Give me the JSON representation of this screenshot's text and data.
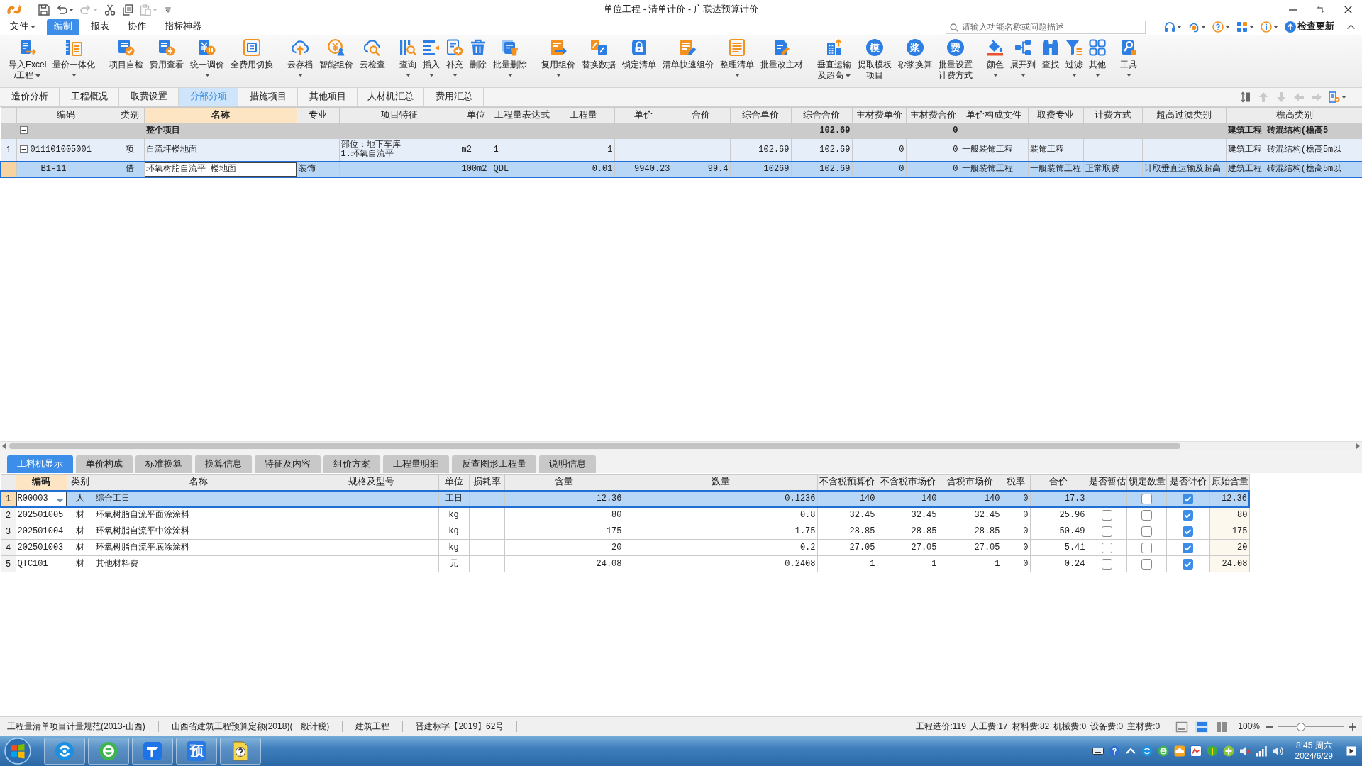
{
  "window": {
    "title": "单位工程 - 清单计价 - 广联达预算计价"
  },
  "quick_access": [
    {
      "kind": "save",
      "disabled": false,
      "dropdown": false
    },
    {
      "kind": "undo",
      "disabled": false,
      "dropdown": true
    },
    {
      "kind": "redo",
      "disabled": true,
      "dropdown": true
    },
    {
      "kind": "cut",
      "disabled": false,
      "dropdown": false
    },
    {
      "kind": "copy",
      "disabled": false,
      "dropdown": false
    },
    {
      "kind": "paste",
      "disabled": true,
      "dropdown": true
    },
    {
      "kind": "customize",
      "disabled": false,
      "dropdown": false
    }
  ],
  "menu": [
    {
      "label": "文件",
      "dropdown": true,
      "selected": false
    },
    {
      "label": "编制",
      "dropdown": false,
      "selected": true
    },
    {
      "label": "报表",
      "dropdown": false,
      "selected": false
    },
    {
      "label": "协作",
      "dropdown": false,
      "selected": false
    },
    {
      "label": "指标神器",
      "dropdown": false,
      "selected": false
    }
  ],
  "search": {
    "placeholder": "请输入功能名称或问题描述"
  },
  "update_button": {
    "label": "检查更新"
  },
  "toolbar": [
    [
      {
        "kind": "import",
        "lines": [
          "导入Excel",
          "/工程"
        ],
        "dropdown": true
      },
      {
        "kind": "bundle",
        "lines": [
          "量价一体化"
        ],
        "dropdown": true
      }
    ],
    [
      {
        "kind": "selfcheck",
        "lines": [
          "项目自检"
        ],
        "dropdown": false
      },
      {
        "kind": "feeview",
        "lines": [
          "费用查看"
        ],
        "dropdown": false
      },
      {
        "kind": "unify",
        "lines": [
          "统一调价"
        ],
        "dropdown": true
      },
      {
        "kind": "fullfee",
        "lines": [
          "全费用切换"
        ],
        "dropdown": false
      }
    ],
    [
      {
        "kind": "cloudup",
        "lines": [
          "云存档"
        ],
        "dropdown": true
      },
      {
        "kind": "smartprice",
        "lines": [
          "智能组价"
        ],
        "dropdown": false
      },
      {
        "kind": "cloudcheck",
        "lines": [
          "云检查"
        ],
        "dropdown": false
      }
    ],
    [
      {
        "kind": "query",
        "lines": [
          "查询"
        ],
        "dropdown": true
      },
      {
        "kind": "insert",
        "lines": [
          "插入"
        ],
        "dropdown": true
      },
      {
        "kind": "supplement",
        "lines": [
          "补充"
        ],
        "dropdown": true
      },
      {
        "kind": "delete",
        "lines": [
          "删除"
        ],
        "dropdown": false
      },
      {
        "kind": "batchdelete",
        "lines": [
          "批量删除"
        ],
        "dropdown": true
      }
    ],
    [
      {
        "kind": "reuse",
        "lines": [
          "复用组价"
        ],
        "dropdown": true
      },
      {
        "kind": "replace",
        "lines": [
          "替换数据"
        ],
        "dropdown": false
      },
      {
        "kind": "lock",
        "lines": [
          "锁定清单"
        ],
        "dropdown": false
      },
      {
        "kind": "quickprice",
        "lines": [
          "清单快速组价"
        ],
        "dropdown": false
      },
      {
        "kind": "organize",
        "lines": [
          "整理清单"
        ],
        "dropdown": true
      },
      {
        "kind": "batchmaterial",
        "lines": [
          "批量改主材"
        ],
        "dropdown": false
      }
    ],
    [
      {
        "kind": "vertical",
        "lines": [
          "垂直运输",
          "及超高"
        ],
        "dropdown": true
      },
      {
        "kind": "glyph",
        "glyph": "模",
        "lines": [
          "提取模板",
          "项目"
        ],
        "dropdown": false
      },
      {
        "kind": "glyph",
        "glyph": "浆",
        "lines": [
          "砂浆换算"
        ],
        "dropdown": false
      },
      {
        "kind": "glyph",
        "glyph": "费",
        "lines": [
          "批量设置",
          "计费方式"
        ],
        "dropdown": false
      }
    ],
    [
      {
        "kind": "color",
        "lines": [
          "颜色"
        ],
        "dropdown": true
      },
      {
        "kind": "expandto",
        "lines": [
          "展开到"
        ],
        "dropdown": true
      },
      {
        "kind": "find",
        "lines": [
          "查找"
        ],
        "dropdown": false
      },
      {
        "kind": "filter",
        "lines": [
          "过滤"
        ],
        "dropdown": true
      },
      {
        "kind": "other",
        "lines": [
          "其他"
        ],
        "dropdown": true
      }
    ],
    [
      {
        "kind": "tools",
        "lines": [
          "工具"
        ],
        "dropdown": true
      }
    ]
  ],
  "main_tabs": [
    {
      "label": "造价分析",
      "selected": false
    },
    {
      "label": "工程概况",
      "selected": false
    },
    {
      "label": "取费设置",
      "selected": false
    },
    {
      "label": "分部分项",
      "selected": true
    },
    {
      "label": "措施项目",
      "selected": false
    },
    {
      "label": "其他项目",
      "selected": false
    },
    {
      "label": "人材机汇总",
      "selected": false
    },
    {
      "label": "费用汇总",
      "selected": false
    }
  ],
  "view_tools": [
    {
      "kind": "sort",
      "disabled": false
    },
    {
      "kind": "up",
      "disabled": true
    },
    {
      "kind": "down",
      "disabled": true
    },
    {
      "kind": "left",
      "disabled": true
    },
    {
      "kind": "right",
      "disabled": true
    },
    {
      "kind": "settings",
      "disabled": false
    }
  ],
  "bill_table": {
    "columns": [
      {
        "label": "编码",
        "selected": false
      },
      {
        "label": "类别",
        "selected": false
      },
      {
        "label": "名称",
        "selected": true
      },
      {
        "label": "专业",
        "selected": false
      },
      {
        "label": "项目特征",
        "selected": false
      },
      {
        "label": "单位",
        "selected": false
      },
      {
        "label": "工程量表达式",
        "selected": false
      },
      {
        "label": "工程量",
        "selected": false
      },
      {
        "label": "单价",
        "selected": false
      },
      {
        "label": "合价",
        "selected": false
      },
      {
        "label": "综合单价",
        "selected": false
      },
      {
        "label": "综合合价",
        "selected": false
      },
      {
        "label": "主材费单价",
        "selected": false
      },
      {
        "label": "主材费合价",
        "selected": false
      },
      {
        "label": "单价构成文件",
        "selected": false
      },
      {
        "label": "取费专业",
        "selected": false
      },
      {
        "label": "计费方式",
        "selected": false
      },
      {
        "label": "超高过滤类别",
        "selected": false
      },
      {
        "label": "檐高类别",
        "selected": false
      }
    ],
    "rows": [
      {
        "kind": "group",
        "expanded": true,
        "selected": false,
        "editing": false,
        "name": "整个项目",
        "composite_amount": "102.69",
        "main_amount": "0",
        "eave_type": "建筑工程 砖混结构(檐高5"
      },
      {
        "kind": "item",
        "number": "1",
        "expanded": true,
        "selected": false,
        "editing": false,
        "code": "011101005001",
        "type": "项",
        "name": "自流坪楼地面",
        "features": "部位：地下车库\n1.环氧自流平",
        "unit": "m2",
        "qty_expr": "1",
        "qty": "1",
        "composite_price": "102.69",
        "composite_amount": "102.69",
        "main_price": "0",
        "main_amount": "0",
        "price_file": "一般装饰工程",
        "fee_specialty": "装饰工程",
        "eave_type": "建筑工程 砖混结构(檐高5m以"
      },
      {
        "kind": "sub",
        "selected": true,
        "editing": true,
        "code": "B1-11",
        "type": "借",
        "name": "环氧树脂自流平 楼地面",
        "specialty": "装饰",
        "unit": "100m2",
        "qty_expr": "QDL",
        "qty": "0.01",
        "unit_price": "9940.23",
        "amount": "99.4",
        "composite_price": "10269",
        "composite_amount": "102.69",
        "main_price": "0",
        "main_amount": "0",
        "price_file": "一般装饰工程",
        "fee_specialty": "一般装饰工程",
        "fee_method": "正常取费",
        "height_filter": "计取垂直运输及超高",
        "eave_type": "建筑工程 砖混结构(檐高5m以"
      }
    ]
  },
  "resource_tabs": [
    {
      "label": "工料机显示",
      "selected": true
    },
    {
      "label": "单价构成",
      "selected": false
    },
    {
      "label": "标准换算",
      "selected": false
    },
    {
      "label": "换算信息",
      "selected": false
    },
    {
      "label": "特征及内容",
      "selected": false
    },
    {
      "label": "组价方案",
      "selected": false
    },
    {
      "label": "工程量明细",
      "selected": false
    },
    {
      "label": "反查图形工程量",
      "selected": false
    },
    {
      "label": "说明信息",
      "selected": false
    }
  ],
  "resource_table": {
    "columns": [
      {
        "label": "编码",
        "selected": true
      },
      {
        "label": "类别",
        "selected": false
      },
      {
        "label": "名称",
        "selected": false
      },
      {
        "label": "规格及型号",
        "selected": false
      },
      {
        "label": "单位",
        "selected": false
      },
      {
        "label": "损耗率",
        "selected": false
      },
      {
        "label": "含量",
        "selected": false
      },
      {
        "label": "数量",
        "selected": false
      },
      {
        "label": "不含税预算价",
        "selected": false
      },
      {
        "label": "不含税市场价",
        "selected": false
      },
      {
        "label": "含税市场价",
        "selected": false
      },
      {
        "label": "税率",
        "selected": false
      },
      {
        "label": "合价",
        "selected": false
      },
      {
        "label": "是否暂估",
        "selected": false
      },
      {
        "label": "锁定数量",
        "selected": false
      },
      {
        "label": "是否计价",
        "selected": false
      },
      {
        "label": "原始含量",
        "selected": false
      }
    ],
    "rows": [
      {
        "number": "1",
        "selected": true,
        "editing": true,
        "code": "R00003",
        "type": "人",
        "name": "综合工日",
        "unit": "工日",
        "content": "12.36",
        "quantity": "0.1236",
        "price_ex": "140",
        "market_ex": "140",
        "market_inc": "140",
        "tax": "0",
        "total": "17.3",
        "locked": false,
        "priced": true,
        "original": "12.36"
      },
      {
        "number": "2",
        "selected": false,
        "editing": false,
        "code": "202501005",
        "type": "材",
        "name": "环氧树脂自流平面涂涂料",
        "unit": "kg",
        "content": "80",
        "quantity": "0.8",
        "price_ex": "32.45",
        "market_ex": "32.45",
        "market_inc": "32.45",
        "tax": "0",
        "total": "25.96",
        "provisional": false,
        "locked": false,
        "priced": true,
        "original": "80"
      },
      {
        "number": "3",
        "selected": false,
        "editing": false,
        "code": "202501004",
        "type": "材",
        "name": "环氧树脂自流平中涂涂料",
        "unit": "kg",
        "content": "175",
        "quantity": "1.75",
        "price_ex": "28.85",
        "market_ex": "28.85",
        "market_inc": "28.85",
        "tax": "0",
        "total": "50.49",
        "provisional": false,
        "locked": false,
        "priced": true,
        "original": "175"
      },
      {
        "number": "4",
        "selected": false,
        "editing": false,
        "code": "202501003",
        "type": "材",
        "name": "环氧树脂自流平底涂涂料",
        "unit": "kg",
        "content": "20",
        "quantity": "0.2",
        "price_ex": "27.05",
        "market_ex": "27.05",
        "market_inc": "27.05",
        "tax": "0",
        "total": "5.41",
        "provisional": false,
        "locked": false,
        "priced": true,
        "original": "20"
      },
      {
        "number": "5",
        "selected": false,
        "editing": false,
        "code": "QTC101",
        "type": "材",
        "name": "其他材料费",
        "unit": "元",
        "content": "24.08",
        "quantity": "0.2408",
        "price_ex": "1",
        "market_ex": "1",
        "market_inc": "1",
        "tax": "0",
        "total": "0.24",
        "provisional": false,
        "locked": false,
        "priced": true,
        "original": "24.08"
      }
    ]
  },
  "status_bar": {
    "specs": [
      "工程量清单项目计量规范(2013-山西)",
      "山西省建筑工程预算定额(2018)(一般计税)",
      "建筑工程",
      "晋建标字【2019】62号"
    ],
    "totals": [
      "工程造价:119",
      "人工费:17",
      "材料费:82",
      "机械费:0",
      "设备费:0",
      "主材费:0"
    ],
    "view_modes": [
      {
        "kind": "layout",
        "selected": false
      },
      {
        "kind": "stacked",
        "selected": true
      },
      {
        "kind": "sidebyside",
        "selected": false
      }
    ],
    "zoom": {
      "label": "100%",
      "level": 0.33
    }
  },
  "taskbar": {
    "apps": [
      {
        "kind": "swirl"
      },
      {
        "kind": "browser"
      },
      {
        "kind": "tile"
      },
      {
        "kind": "glyph",
        "glyph": "预"
      },
      {
        "kind": "helpfile"
      }
    ],
    "clock": {
      "time": "8:45 周六",
      "date": "2024/6/29"
    }
  }
}
